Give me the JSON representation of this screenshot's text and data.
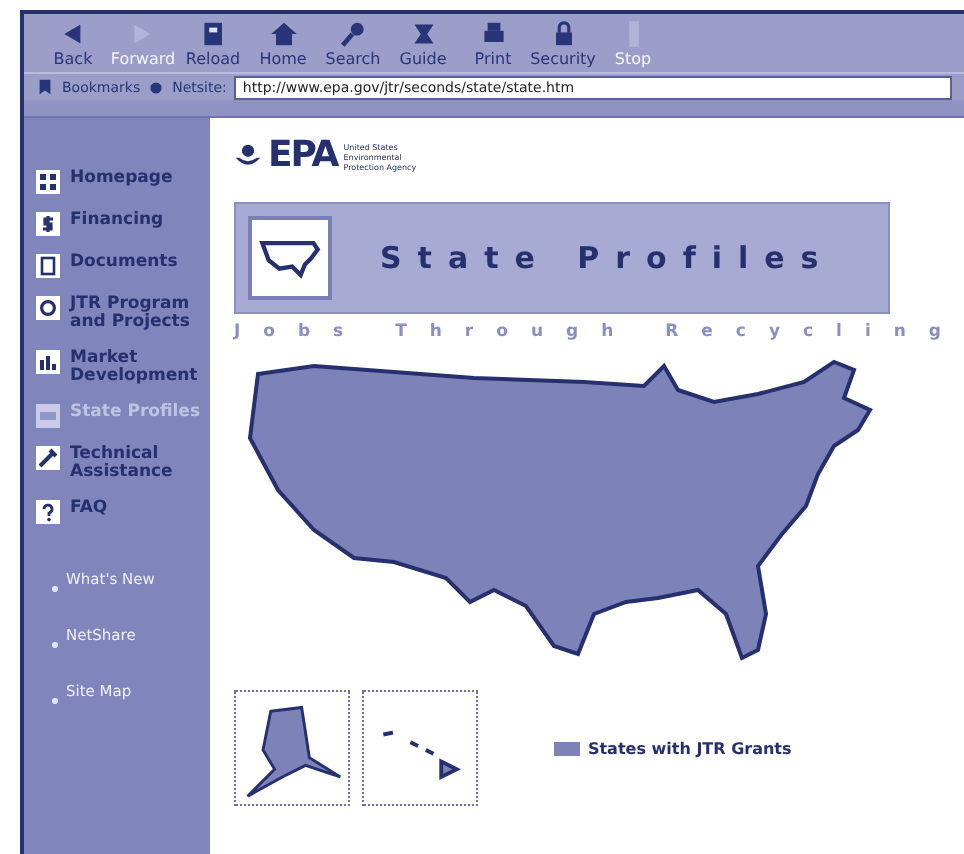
{
  "toolbar": {
    "buttons": [
      {
        "label": "Back",
        "disabled": false
      },
      {
        "label": "Forward",
        "disabled": true
      },
      {
        "label": "Reload",
        "disabled": false
      },
      {
        "label": "Home",
        "disabled": false
      },
      {
        "label": "Search",
        "disabled": false
      },
      {
        "label": "Guide",
        "disabled": false
      },
      {
        "label": "Print",
        "disabled": false
      },
      {
        "label": "Security",
        "disabled": false
      },
      {
        "label": "Stop",
        "disabled": true
      }
    ]
  },
  "location_bar": {
    "bookmarks": "Bookmarks",
    "label": "Netsite:",
    "url": "http://www.epa.gov/jtr/seconds/state/state.htm"
  },
  "sidebar": {
    "items": [
      {
        "label": "Homepage",
        "selected": false
      },
      {
        "label": "Financing",
        "selected": false
      },
      {
        "label": "Documents",
        "selected": false
      },
      {
        "label": "JTR Program and Projects",
        "selected": false
      },
      {
        "label": "Market Development",
        "selected": false
      },
      {
        "label": "State Profiles",
        "selected": true
      },
      {
        "label": "Technical Assistance",
        "selected": false
      },
      {
        "label": "FAQ",
        "selected": false
      }
    ],
    "links": [
      "What's New",
      "NetShare",
      "Site Map"
    ]
  },
  "logo": {
    "mark": "EPA",
    "agency": "United States Environmental Protection Agency"
  },
  "banner": {
    "title": "State Profiles",
    "tagline": "Jobs Through Recycling"
  },
  "legend": {
    "label": "States with JTR Grants"
  }
}
